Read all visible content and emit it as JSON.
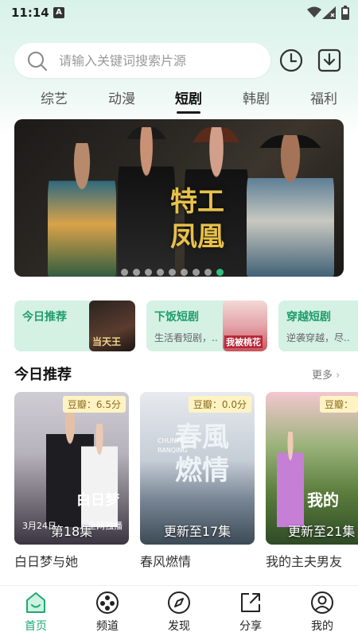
{
  "status": {
    "time": "11:14",
    "a_icon": "A"
  },
  "search": {
    "placeholder": "请输入关键词搜索片源"
  },
  "tabs": [
    {
      "label": "综艺"
    },
    {
      "label": "动漫"
    },
    {
      "label": "短剧",
      "active": true
    },
    {
      "label": "韩剧"
    },
    {
      "label": "福利"
    }
  ],
  "banner": {
    "title": "特工凤凰",
    "dots": 9,
    "active_dot": 9
  },
  "categories": [
    {
      "title": "今日推荐",
      "subtitle": "",
      "thumb_text": "当天王"
    },
    {
      "title": "下饭短剧",
      "subtitle": "生活看短剧，..",
      "thumb_text": "我被桃花"
    },
    {
      "title": "穿越短剧",
      "subtitle": "逆袭穿越，尽..",
      "thumb_text": ""
    }
  ],
  "section": {
    "title": "今日推荐",
    "more": "更多"
  },
  "posters": [
    {
      "name": "白日梦与她",
      "score": "豆瓣：6.5分",
      "episode": "第18集",
      "art_text": "白日梦",
      "date_text": "3月24日",
      "extra_text": "全网独播"
    },
    {
      "name": "春风燃情",
      "score": "豆瓣：0.0分",
      "episode": "更新至17集",
      "art_text": "春風燃情",
      "pinyin": "CHUNFENG RANQING"
    },
    {
      "name": "我的主夫男友",
      "score": "豆瓣：",
      "episode": "更新至21集",
      "art_text": "我的"
    }
  ],
  "nav": [
    {
      "label": "首页",
      "icon": "home-icon",
      "active": true
    },
    {
      "label": "频道",
      "icon": "channel-icon"
    },
    {
      "label": "发现",
      "icon": "compass-icon"
    },
    {
      "label": "分享",
      "icon": "share-icon"
    },
    {
      "label": "我的",
      "icon": "profile-icon"
    }
  ],
  "colors": {
    "accent": "#1fa872",
    "card_bg": "#d4f1e4",
    "score_bg": "#fff3c4"
  }
}
